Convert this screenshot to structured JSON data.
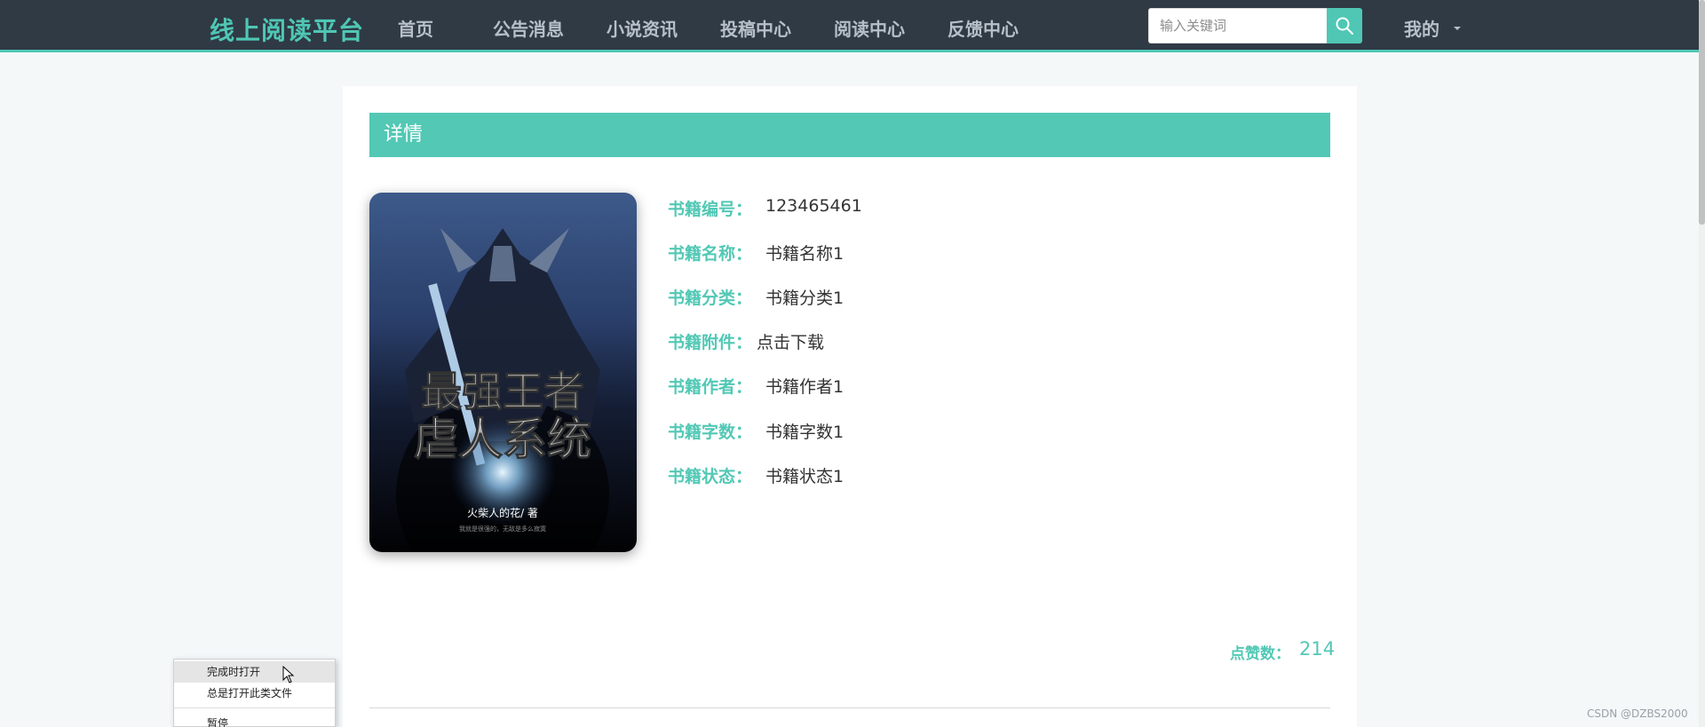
{
  "nav": {
    "brand": "线上阅读平台",
    "items": [
      "首页",
      "公告消息",
      "小说资讯",
      "投稿中心",
      "阅读中心",
      "反馈中心"
    ],
    "search_placeholder": "输入关键词",
    "me_label": "我的"
  },
  "detail": {
    "header": "详情",
    "cover": {
      "title_line1": "最强王者",
      "title_line2": "虐人系统",
      "author": "火柴人的花/ 著",
      "tagline": "我就是很强的，无敌是多么寂寞"
    },
    "fields": [
      {
        "label": "书籍编号：",
        "value": "123465461"
      },
      {
        "label": "书籍名称：",
        "value": "书籍名称1"
      },
      {
        "label": "书籍分类：",
        "value": "书籍分类1"
      },
      {
        "label": "书籍附件：",
        "value": "点击下载"
      },
      {
        "label": "书籍作者：",
        "value": "书籍作者1"
      },
      {
        "label": "书籍字数：",
        "value": "书籍字数1"
      },
      {
        "label": "书籍状态：",
        "value": "书籍状态1"
      }
    ],
    "likes_label": "点赞数：",
    "likes_value": "214"
  },
  "context_menu": {
    "items": [
      "完成时打开",
      "总是打开此类文件",
      "暂停"
    ]
  },
  "watermark": "CSDN @DZBS2000",
  "colors": {
    "accent": "#52c8b5",
    "nav_bg": "#2f3a45"
  }
}
